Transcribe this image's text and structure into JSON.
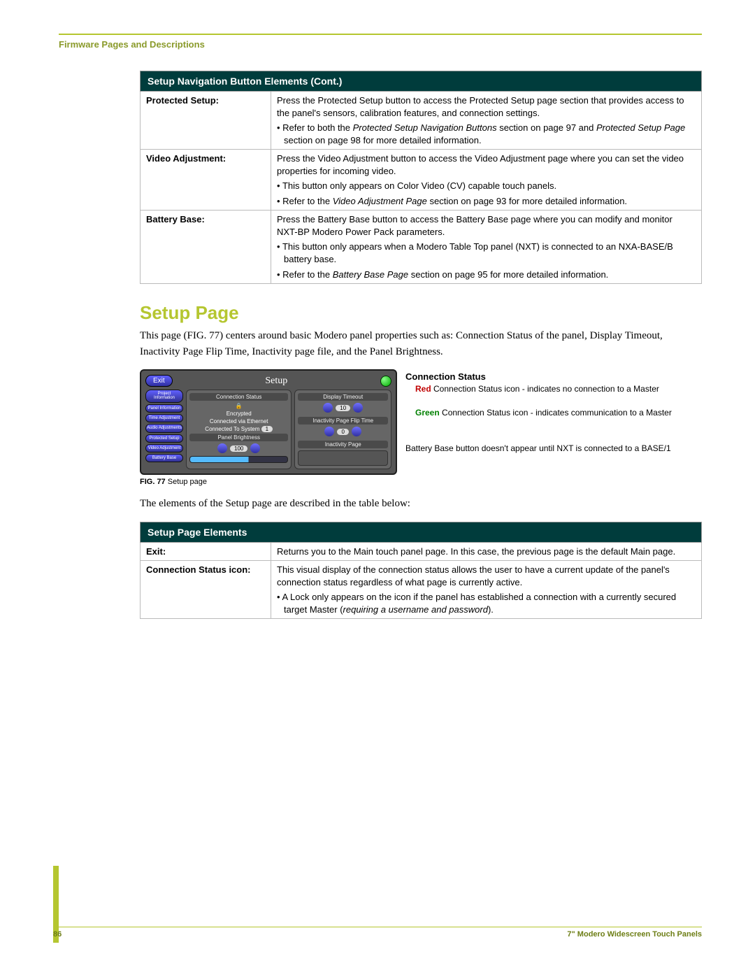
{
  "header": {
    "section": "Firmware Pages and Descriptions"
  },
  "table1": {
    "title": "Setup Navigation Button Elements (Cont.)",
    "rows": [
      {
        "label": "Protected Setup:",
        "main": "Press the Protected Setup button to access the Protected Setup page section that provides access to the panel's sensors, calibration features, and connection settings.",
        "b1a": "Refer to both the ",
        "b1b": "Protected Setup Navigation Buttons",
        "b1c": " section on page 97 and ",
        "b1d": "Protected Setup Page",
        "b1e": " section on page 98 for more detailed information."
      },
      {
        "label": "Video Adjustment:",
        "main": "Press the Video Adjustment button to access the Video Adjustment page where you can set the video properties for incoming video.",
        "b1": "This button only appears on Color Video (CV) capable touch panels.",
        "b2a": "Refer to the ",
        "b2b": "Video Adjustment Page",
        "b2c": " section on page 93 for more detailed information."
      },
      {
        "label": "Battery Base:",
        "main": "Press the Battery Base button to access the Battery Base page where you can modify and monitor NXT-BP Modero Power Pack parameters.",
        "b1": "This button only appears when a Modero Table Top panel (NXT) is connected to an NXA-BASE/B battery base.",
        "b2a": "Refer to the ",
        "b2b": "Battery Base Page",
        "b2c": " section on page 95 for more detailed information."
      }
    ]
  },
  "setup": {
    "heading": "Setup Page",
    "intro": "This page (FIG. 77) centers around basic Modero panel properties such as: Connection Status of the panel, Display Timeout, Inactivity Page Flip Time, Inactivity page file, and the Panel Brightness."
  },
  "device": {
    "exit": "Exit",
    "title": "Setup",
    "sideTabs": [
      "Project Information",
      "Panel Information",
      "Time Adjustment",
      "Audio Adjustments",
      "Protected Setup",
      "Video Adjustment",
      "Battery Base"
    ],
    "connStatusHdr": "Connection Status",
    "encrypted": "Encrypted",
    "via": "Connected via Ethernet",
    "toSystem": "Connected To System",
    "sysNum": "1",
    "brightnessHdr": "Panel Brightness",
    "brightnessVal": "100",
    "dispTimeoutHdr": "Display Timeout",
    "dispTimeoutVal": "10",
    "inactFlipHdr": "Inactivity Page Flip Time",
    "inactFlipVal": "0",
    "inactPageHdr": "Inactivity Page"
  },
  "annot": {
    "title": "Connection Status",
    "red1": "Red",
    "red2": " Connection Status icon - indicates no connection to a Master",
    "green1": "Green",
    "green2": " Connection Status icon - indicates communication to a Master",
    "bb": "Battery Base button doesn't appear until NXT is connected to a BASE/1"
  },
  "figcap": {
    "num": "FIG. 77",
    "text": "  Setup page"
  },
  "para2": "The elements of the Setup page are described in the table below:",
  "table2": {
    "title": "Setup Page Elements",
    "rows": [
      {
        "label": "Exit:",
        "main": "Returns you to the Main touch panel page. In this case, the previous page is the default Main page."
      },
      {
        "label": "Connection Status icon:",
        "main": "This visual display of the connection status allows the user to have a current update of the panel's connection status regardless of what page is currently active.",
        "b1a": "A Lock only appears on the icon if the panel has established a connection with a currently secured target Master (",
        "b1b": "requiring a username and password",
        "b1c": ")."
      }
    ]
  },
  "footer": {
    "page": "86",
    "doc": "7\" Modero Widescreen Touch Panels"
  }
}
